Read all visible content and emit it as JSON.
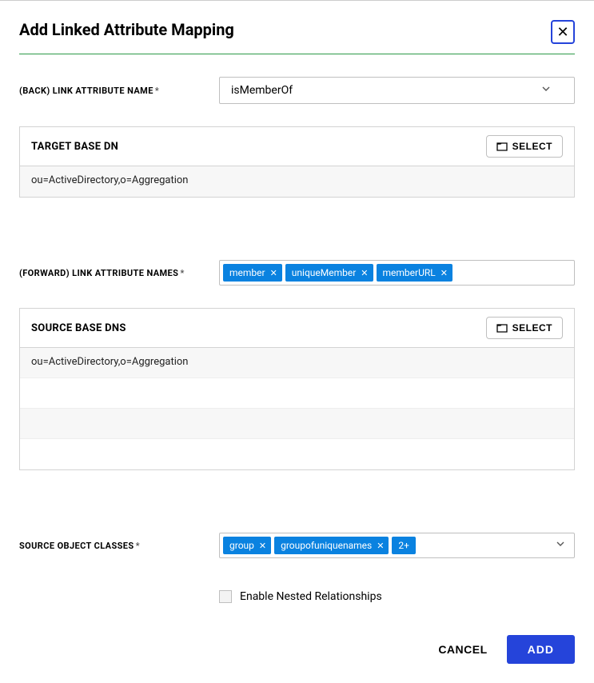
{
  "modal": {
    "title": "Add Linked Attribute Mapping",
    "closeLabel": "✕"
  },
  "backLink": {
    "label": "(BACK) LINK ATTRIBUTE NAME",
    "value": "isMemberOf"
  },
  "targetBaseDn": {
    "title": "TARGET BASE DN",
    "selectLabel": "SELECT",
    "rows": [
      "ou=ActiveDirectory,o=Aggregation"
    ]
  },
  "forwardLink": {
    "label": "(FORWARD) LINK ATTRIBUTE NAMES",
    "tags": [
      "member",
      "uniqueMember",
      "memberURL"
    ]
  },
  "sourceBaseDns": {
    "title": "SOURCE BASE DNS",
    "selectLabel": "SELECT",
    "rows": [
      "ou=ActiveDirectory,o=Aggregation",
      "",
      "",
      ""
    ]
  },
  "sourceObjectClasses": {
    "label": "SOURCE OBJECT CLASSES",
    "tags": [
      "group",
      "groupofuniquenames"
    ],
    "more": "2+"
  },
  "nested": {
    "label": "Enable Nested Relationships",
    "checked": false
  },
  "footer": {
    "cancel": "CANCEL",
    "add": "ADD"
  }
}
